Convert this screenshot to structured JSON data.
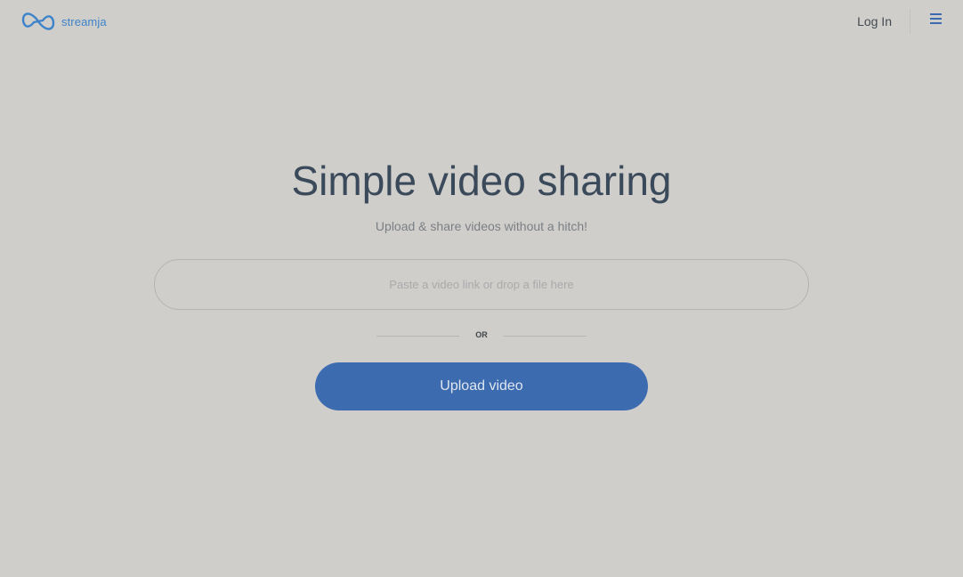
{
  "header": {
    "brand_name": "streamja",
    "logo_icon": "infinity-logo-icon",
    "login_label": "Log In",
    "menu_icon": "hamburger-menu-icon",
    "brand_color": "#3d83c9",
    "accent_color": "#3d6bb0"
  },
  "main": {
    "title": "Simple video sharing",
    "subtitle": "Upload & share videos without a hitch!",
    "link_input": {
      "value": "",
      "placeholder": "Paste a video link or drop a file here"
    },
    "separator_label": "OR",
    "upload_button_label": "Upload video"
  }
}
